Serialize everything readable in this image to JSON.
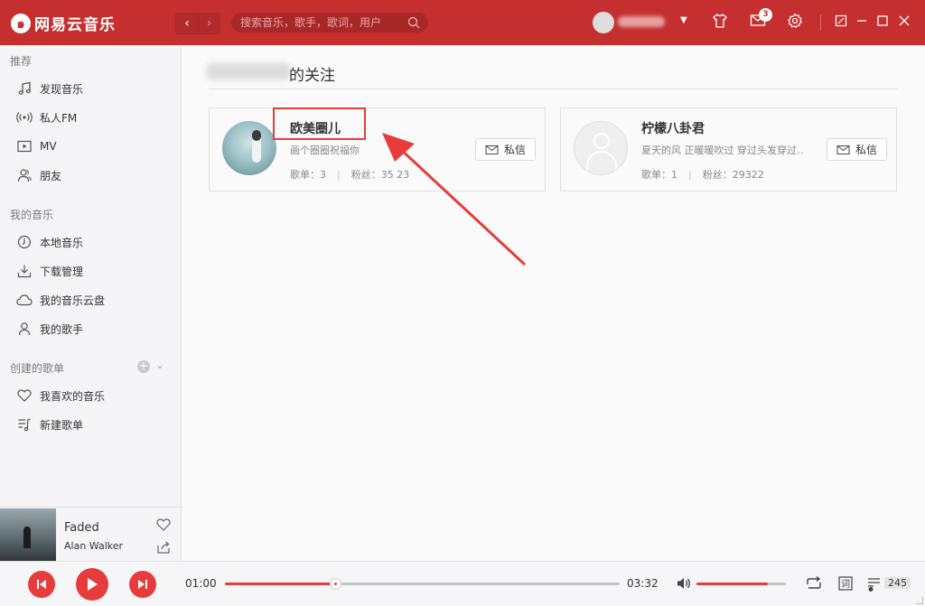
{
  "app": {
    "logo_mark": "๑",
    "logo_text": "网易云音乐"
  },
  "nav": {
    "back": "‹",
    "forward": "›"
  },
  "search": {
    "placeholder": "搜索音乐，歌手，歌词，用户"
  },
  "header": {
    "badge_count": "3",
    "dropdown": "▼"
  },
  "sidebar": {
    "recommend_title": "推荐",
    "recommend_items": [
      {
        "label": "发现音乐",
        "icon": "music-note-icon"
      },
      {
        "label": "私人FM",
        "icon": "radio-icon"
      },
      {
        "label": "MV",
        "icon": "video-icon"
      },
      {
        "label": "朋友",
        "icon": "friends-icon"
      }
    ],
    "mymusic_title": "我的音乐",
    "mymusic_items": [
      {
        "label": "本地音乐",
        "icon": "local-music-icon"
      },
      {
        "label": "下载管理",
        "icon": "download-icon"
      },
      {
        "label": "我的音乐云盘",
        "icon": "cloud-icon"
      },
      {
        "label": "我的歌手",
        "icon": "singer-icon"
      }
    ],
    "playlists_title": "创建的歌单",
    "plus": "+",
    "chevron": "⌄",
    "playlist_items": [
      {
        "label": "我喜欢的音乐",
        "icon": "heart-icon"
      },
      {
        "label": "新建歌单",
        "icon": "playlist-icon"
      }
    ]
  },
  "now_playing": {
    "title": "Faded",
    "artist": "Alan Walker"
  },
  "main": {
    "page_title": "的关注",
    "cards": [
      {
        "name": "欧美圈儿",
        "desc": "画个圈圈祝福你",
        "playlists_label": "歌单：3",
        "separator": "|",
        "fans_label": "粉丝：35 23",
        "button_label": "私信"
      },
      {
        "name": "柠檬八卦君",
        "desc": "夏天的风 正暖暖吹过 穿过头发穿过…",
        "playlists_label": "歌单：1",
        "separator": "|",
        "fans_label": "粉丝：29322",
        "button_label": "私信"
      }
    ]
  },
  "player": {
    "current_time": "01:00",
    "total_time": "03:32",
    "progress": 0.28,
    "volume": 0.8,
    "lyrics_label": "词",
    "playlist_count": "245"
  },
  "colors": {
    "brand_red": "#c62f2f",
    "accent_red": "#e83c3c"
  }
}
